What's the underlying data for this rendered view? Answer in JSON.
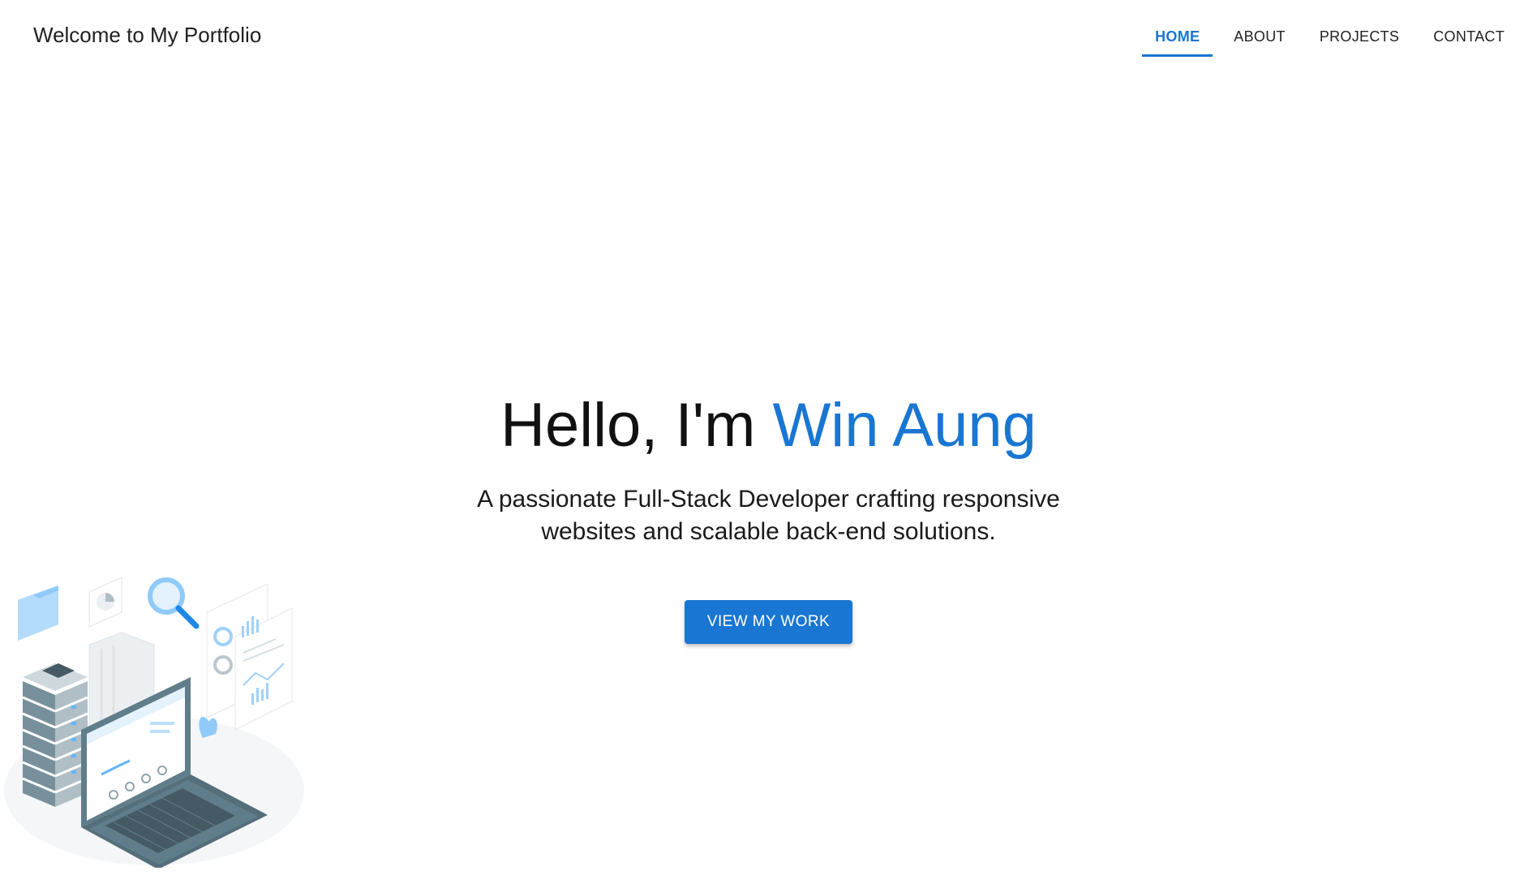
{
  "header": {
    "title": "Welcome to My Portfolio",
    "nav": [
      {
        "label": "HOME",
        "active": true
      },
      {
        "label": "ABOUT",
        "active": false
      },
      {
        "label": "PROJECTS",
        "active": false
      },
      {
        "label": "CONTACT",
        "active": false
      }
    ]
  },
  "hero": {
    "greeting": "Hello, I'm",
    "name": "Win Aung",
    "subtitle": "A passionate Full-Stack Developer crafting responsive websites and scalable back-end solutions.",
    "cta_label": "VIEW MY WORK"
  },
  "illustration": {
    "icon": "developer-workspace-illustration"
  },
  "colors": {
    "accent": "#1976d2",
    "text": "#212121",
    "background": "#ffffff"
  }
}
